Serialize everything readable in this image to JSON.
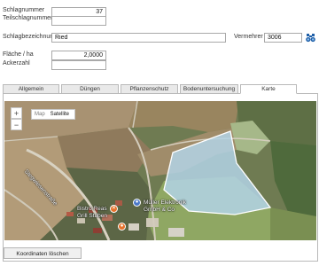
{
  "form": {
    "schlagnummer_label": "Schlagnummer",
    "schlagnummer_value": "37",
    "teilschlagnummer_label": "Teilschlagnummer",
    "teilschlagnummer_value": "",
    "bezeichnung_label": "Schlagbezeichnung",
    "bezeichnung_value": "Ried",
    "vermehrer_label": "Vermehrer",
    "vermehrer_value": "3006",
    "flaeche_label": "Fläche / ha",
    "flaeche_value": "2,0000",
    "ackerzahl_label": "Ackerzahl",
    "ackerzahl_value": ""
  },
  "tabs": [
    {
      "label": "Allgemein",
      "active": false
    },
    {
      "label": "Düngen",
      "active": false
    },
    {
      "label": "Pflanzenschutz",
      "active": false
    },
    {
      "label": "Bodenuntersuchung",
      "active": false
    },
    {
      "label": "Karte",
      "active": true
    }
  ],
  "map": {
    "zoom_in": "+",
    "zoom_out": "−",
    "type_map": "Map",
    "type_satellite": "Satellite",
    "selected_type": "Satellite",
    "street_label": "Stegwiesenstraße",
    "poi_1": "Bistro Reas",
    "poi_2": "Grill Stuben",
    "poi_3_line1": "Müller Elektronik",
    "poi_3_line2": "GmbH & Co",
    "polygon_fill": "#b3d3e6",
    "polygon_stroke": "#ffffff"
  },
  "actions": {
    "clear_coordinates": "Koordinaten löschen"
  },
  "colors": {
    "tab_active_bg": "#ffffff",
    "tab_bg": "#e9e9e9",
    "border": "#b9b9b9",
    "binoculars_icon": "#1f5fa8"
  }
}
